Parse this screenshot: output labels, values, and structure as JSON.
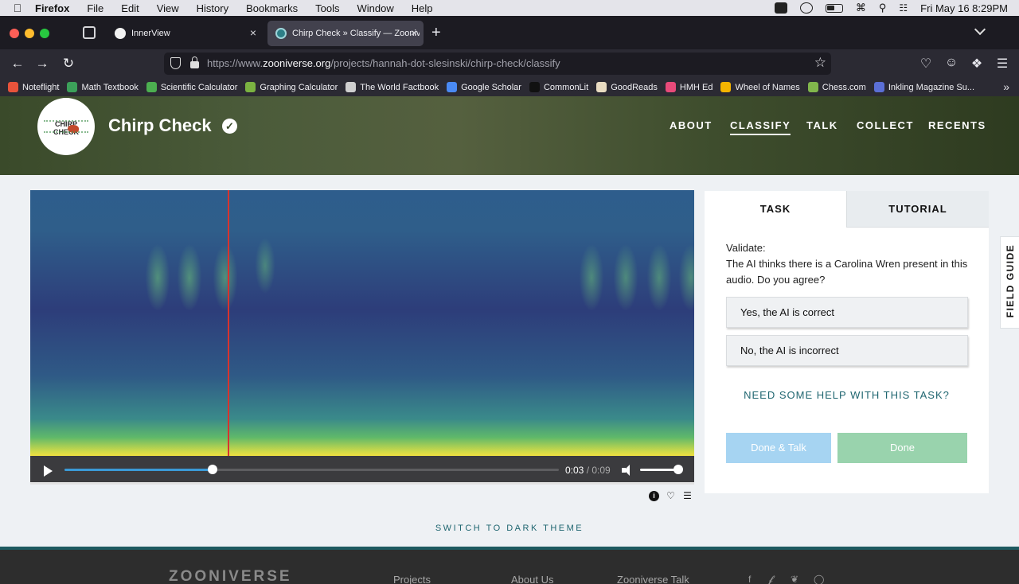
{
  "menubar": {
    "app": "Firefox",
    "items": [
      "File",
      "Edit",
      "View",
      "History",
      "Bookmarks",
      "Tools",
      "Window",
      "Help"
    ],
    "datetime": "Fri May 16  8:29PM"
  },
  "tabs": [
    {
      "label": "InnerView",
      "active": false
    },
    {
      "label": "Chirp Check » Classify — Zooniv",
      "active": true
    }
  ],
  "urlbar": {
    "url_prefix": "https://www.",
    "url_domain": "zooniverse.org",
    "url_path": "/projects/hannah-dot-slesinski/chirp-check/classify"
  },
  "bookmarks": [
    {
      "label": "Noteflight",
      "color": "#e8533b"
    },
    {
      "label": "Math Textbook",
      "color": "#3ca05a"
    },
    {
      "label": "Scientific Calculator",
      "color": "#4caf50"
    },
    {
      "label": "Graphing Calculator",
      "color": "#7bb241"
    },
    {
      "label": "The World Factbook",
      "color": "#cfcfcf"
    },
    {
      "label": "Google Scholar",
      "color": "#4a8af4"
    },
    {
      "label": "CommonLit",
      "color": "#111111"
    },
    {
      "label": "GoodReads",
      "color": "#e9dcc2"
    },
    {
      "label": "HMH Ed",
      "color": "#e84a7a"
    },
    {
      "label": "Wheel of Names",
      "color": "#f4b400"
    },
    {
      "label": "Chess.com",
      "color": "#81b64c"
    },
    {
      "label": "Inkling Magazine Su...",
      "color": "#5b6fd6"
    }
  ],
  "site": {
    "logo_text_1": "CHIRP",
    "logo_text_2": "CHECK",
    "title": "Chirp Check",
    "nav": [
      {
        "label": "ABOUT",
        "active": false
      },
      {
        "label": "CLASSIFY",
        "active": true
      },
      {
        "label": "TALK",
        "active": false
      },
      {
        "label": "COLLECT",
        "active": false
      },
      {
        "label": "RECENTS",
        "active": false
      }
    ]
  },
  "player": {
    "current_time": "0:03",
    "separator": " / ",
    "duration": "0:09",
    "progress": 0.3,
    "volume": 0.9
  },
  "panel": {
    "tab_task": "TASK",
    "tab_tutorial": "TUTORIAL",
    "question_heading": "Validate:",
    "question_body": "The AI thinks there is a Carolina Wren present in this audio. Do you agree?",
    "answers": [
      "Yes, the AI is correct",
      "No, the AI is incorrect"
    ],
    "help_link": "NEED SOME HELP WITH THIS TASK?",
    "done_talk": "Done & Talk",
    "done": "Done",
    "done_talk_color": "#a6d4f2",
    "done_color": "#99d3ad"
  },
  "field_guide": "FIELD GUIDE",
  "dark_theme": "SWITCH TO DARK THEME",
  "footer": {
    "logo": "ZOONIVERSE",
    "links": [
      "Projects",
      "About Us",
      "Zooniverse Talk"
    ],
    "social_icons": [
      "facebook-icon",
      "twitter-icon",
      "bluesky-icon",
      "instagram-icon"
    ]
  }
}
